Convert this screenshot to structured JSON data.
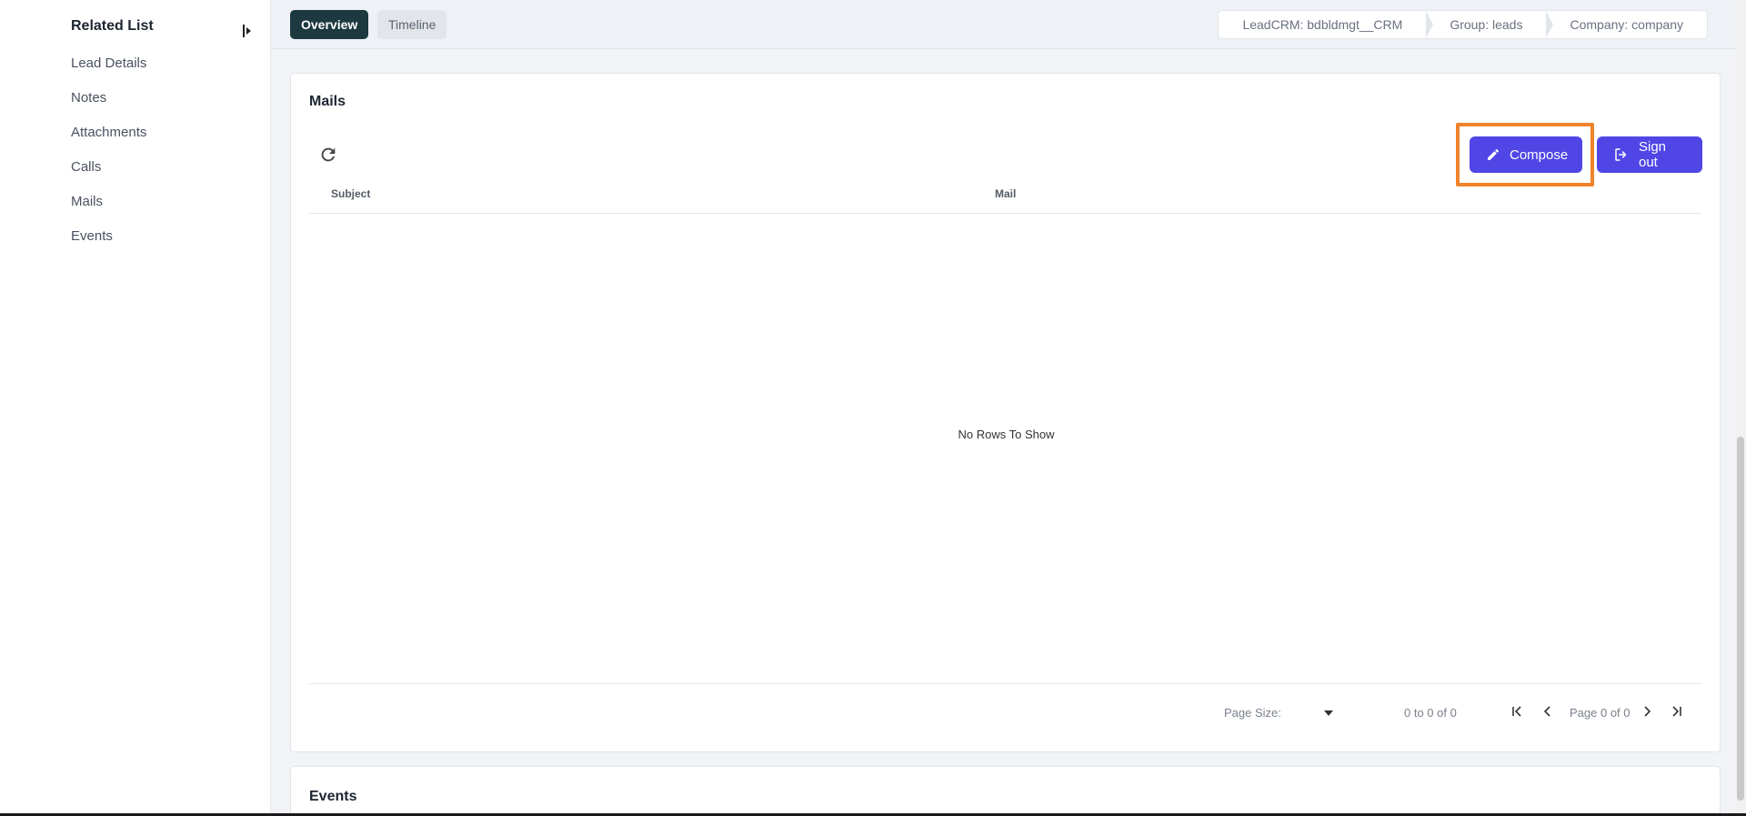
{
  "sidebar": {
    "title": "Related List",
    "items": [
      {
        "label": "Lead Details"
      },
      {
        "label": "Notes"
      },
      {
        "label": "Attachments"
      },
      {
        "label": "Calls"
      },
      {
        "label": "Mails"
      },
      {
        "label": "Events"
      }
    ]
  },
  "tabs": {
    "overview": "Overview",
    "timeline": "Timeline"
  },
  "breadcrumbs": [
    {
      "label": "LeadCRM: bdbldmgt__CRM"
    },
    {
      "label": "Group: leads"
    },
    {
      "label": "Company: company"
    }
  ],
  "mails": {
    "title": "Mails",
    "compose_label": "Compose",
    "signout_label": "Sign out",
    "columns": {
      "subject": "Subject",
      "mail": "Mail"
    },
    "empty_message": "No Rows To Show",
    "pagination": {
      "page_size_label": "Page Size:",
      "range_label": "0 to 0 of 0",
      "page_label": "Page 0 of 0"
    }
  },
  "events": {
    "title": "Events"
  },
  "colors": {
    "accent": "#5046e5",
    "active_tab": "#1c3940",
    "highlight": "#f0832a"
  },
  "icons": [
    "collapse-icon",
    "refresh-icon",
    "pencil-icon",
    "logout-icon",
    "first-page-icon",
    "prev-page-icon",
    "next-page-icon",
    "last-page-icon",
    "caret-down-icon"
  ]
}
